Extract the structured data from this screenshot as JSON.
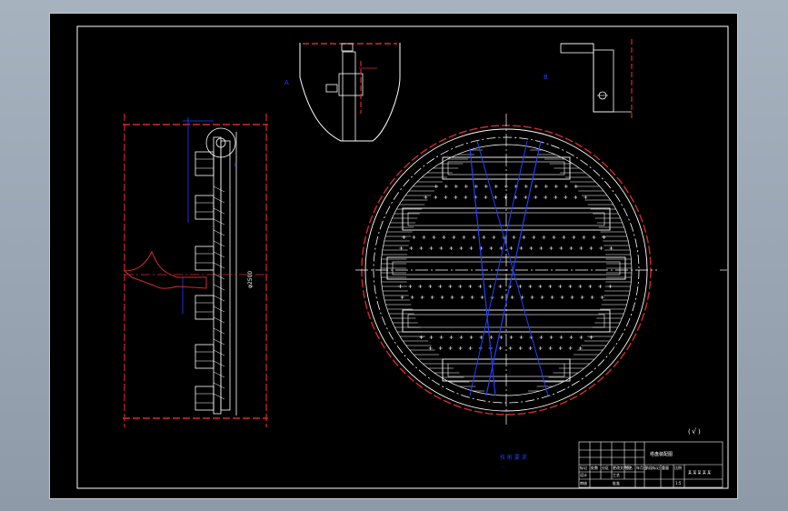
{
  "drawing": {
    "dimension_height": "φ2500",
    "note_title": "技 術 要 求",
    "note_line": "…",
    "roughness_symbol": "√"
  },
  "title_block": {
    "drawing_title": "塔盘装配图",
    "part_name": "某 某 某 某 某",
    "scale": "1:5",
    "labels": [
      "标记",
      "处数",
      "分区",
      "更改文件号",
      "签名",
      "年月日"
    ],
    "roles": [
      "设计",
      "审核",
      "工艺",
      "批准"
    ],
    "stage": [
      "阶段标记",
      "重量",
      "比例"
    ]
  },
  "colors": {
    "sheet": "#000000",
    "outline": "#ffffff",
    "center_line": "#d42a2a",
    "dimension": "#1f3fff",
    "background": "#9aa6b4"
  }
}
